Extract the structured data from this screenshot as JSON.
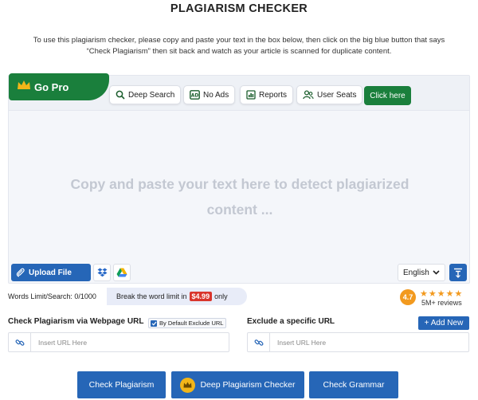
{
  "header": {
    "title": "PLAGIARISM CHECKER",
    "intro_line1": "To use this plagiarism checker, please copy and paste your text in the box below, then click on the big blue button that says",
    "intro_line2": "“Check Plagiarism” then sit back and watch as your article is scanned for duplicate content."
  },
  "toolbar": {
    "gopro_label": "Go Pro",
    "features": [
      {
        "label": "Deep Search",
        "icon": "search-icon"
      },
      {
        "label": "No Ads",
        "icon": "no-ads-icon"
      },
      {
        "label": "Reports",
        "icon": "reports-icon"
      },
      {
        "label": "User Seats",
        "icon": "users-icon"
      }
    ],
    "click_here_label": "Click here"
  },
  "editor": {
    "placeholder_line1": "Copy and paste your text here to detect plagiarized",
    "placeholder_line2": "content ...",
    "upload_label": "Upload File",
    "language": "English"
  },
  "limits": {
    "words_limit": "Words Limit/Search: 0/1000",
    "break_text": "Break the word limit in",
    "price": "$4.99",
    "only": "only"
  },
  "rating": {
    "score": "4.7",
    "stars": "★★★★★",
    "reviews": "5M+ reviews"
  },
  "url_section": {
    "webpage_label": "Check Plagiarism via Webpage URL",
    "exclude_default_label": "By Default Exclude URL",
    "exclude_specific_label": "Exclude a specific URL",
    "add_new_label": "+ Add New",
    "url_placeholder_1": "Insert URL Here",
    "url_placeholder_2": "Insert URL Here"
  },
  "actions": {
    "check_plagiarism": "Check Plagiarism",
    "deep_checker": "Deep Plagiarism Checker",
    "check_grammar": "Check Grammar"
  },
  "colors": {
    "green": "#1a7f3c",
    "blue": "#2666b7",
    "price_red": "#d9352c",
    "star_orange": "#f29a1f"
  }
}
